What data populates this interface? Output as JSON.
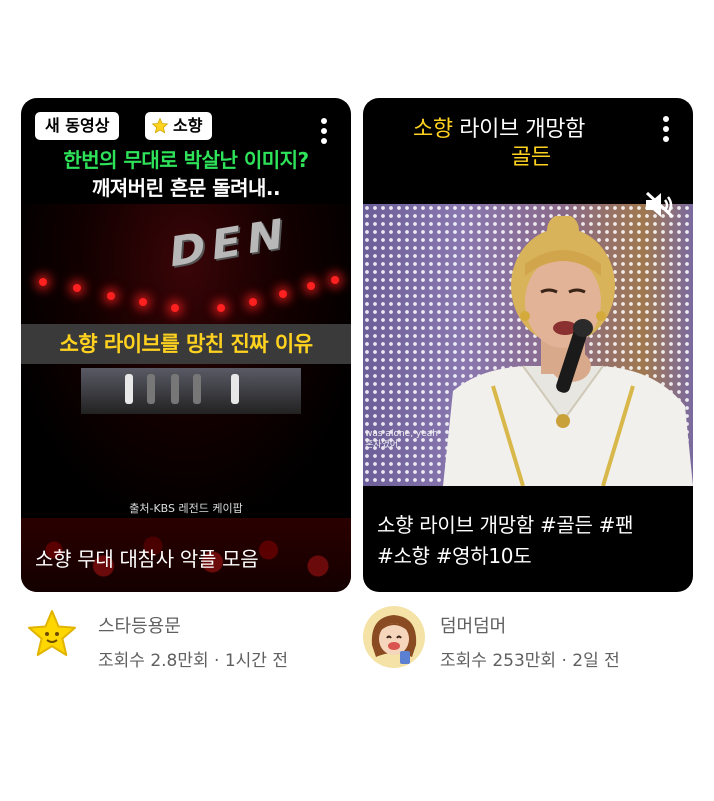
{
  "cards": [
    {
      "badge_new": "새 동영상",
      "badge_category": "소향",
      "headline_line1": "한번의 무대로 박살난 이미지?",
      "headline_line2": "깨져버린 흔문 돌려내..",
      "stage_sign": "DEN",
      "banner": "소향 라이브를 망친 진짜 이유",
      "source": "출처-KBS 레전드 케이팝",
      "title": "소향 무대 대참사 악플 모음",
      "channel": "스타등용문",
      "stats": "조회수 2.8만회 · 1시간 전",
      "avatar_icon": "star-icon",
      "menu_icon": "more-vert-icon"
    },
    {
      "overlay_line1_highlight": "소향",
      "overlay_line1_rest": " 라이브 개망함",
      "overlay_line2": "골든",
      "video_caption_line1": "was alone, yeah",
      "video_caption_line2": "혼자였어",
      "title_line1": "소향 라이브 개망함 #골든 #팬",
      "title_line2": "#소향 #영하10도",
      "channel": "덤머덤머",
      "stats": "조회수 253만회 · 2일 전",
      "avatar_icon": "cartoon-girl-avatar",
      "mute_icon": "volume-muted-icon",
      "menu_icon": "more-vert-icon"
    }
  ],
  "colors": {
    "headline_green": "#2ee35a",
    "highlight_yellow": "#ffd21f",
    "card_bg": "#000000",
    "meta_text": "#606060"
  }
}
